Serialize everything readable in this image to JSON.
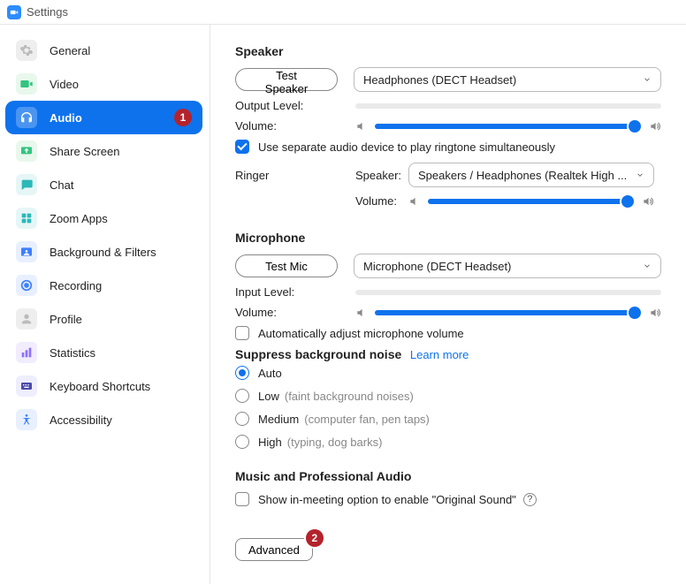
{
  "window": {
    "title": "Settings"
  },
  "sidebar": {
    "items": [
      {
        "label": "General"
      },
      {
        "label": "Video"
      },
      {
        "label": "Audio"
      },
      {
        "label": "Share Screen"
      },
      {
        "label": "Chat"
      },
      {
        "label": "Zoom Apps"
      },
      {
        "label": "Background & Filters"
      },
      {
        "label": "Recording"
      },
      {
        "label": "Profile"
      },
      {
        "label": "Statistics"
      },
      {
        "label": "Keyboard Shortcuts"
      },
      {
        "label": "Accessibility"
      }
    ]
  },
  "annotations": {
    "sidebar_badge": "1",
    "advanced_badge": "2"
  },
  "speaker": {
    "title": "Speaker",
    "test_button": "Test Speaker",
    "device": "Headphones (DECT Headset)",
    "output_label": "Output Level:",
    "volume_label": "Volume:",
    "ringtone_checkbox": "Use separate audio device to play ringtone simultaneously"
  },
  "ringer": {
    "label": "Ringer",
    "speaker_label": "Speaker:",
    "speaker_device": "Speakers / Headphones (Realtek High ...",
    "volume_label": "Volume:"
  },
  "microphone": {
    "title": "Microphone",
    "test_button": "Test Mic",
    "device": "Microphone (DECT Headset)",
    "input_label": "Input Level:",
    "volume_label": "Volume:",
    "auto_adjust": "Automatically adjust microphone volume"
  },
  "suppress": {
    "title": "Suppress background noise",
    "learn_more": "Learn more",
    "options": [
      {
        "label": "Auto",
        "hint": ""
      },
      {
        "label": "Low",
        "hint": "(faint background noises)"
      },
      {
        "label": "Medium",
        "hint": "(computer fan, pen taps)"
      },
      {
        "label": "High",
        "hint": "(typing, dog barks)"
      }
    ]
  },
  "music": {
    "title": "Music and Professional Audio",
    "original_sound": "Show in-meeting option to enable \"Original Sound\""
  },
  "advanced": {
    "label": "Advanced"
  }
}
